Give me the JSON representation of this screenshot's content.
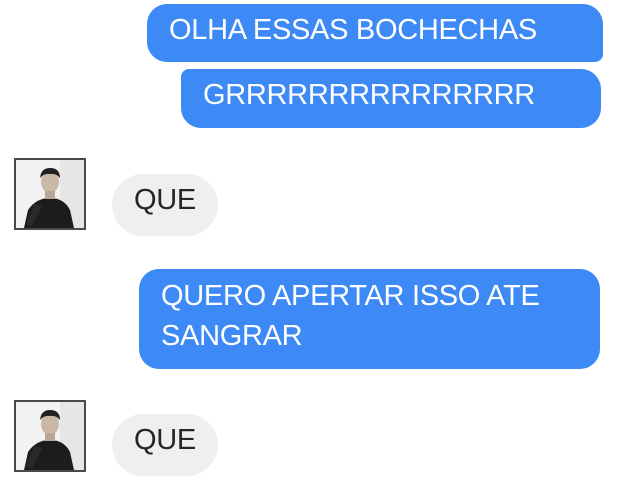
{
  "messages": [
    {
      "direction": "outgoing",
      "text": "OLHA ESSAS BOCHECHAS"
    },
    {
      "direction": "outgoing",
      "text": "GRRRRRRRRRRRRRRR"
    },
    {
      "direction": "incoming",
      "text": "QUE"
    },
    {
      "direction": "outgoing",
      "text": "QUERO APERTAR ISSO ATE SANGRAR"
    },
    {
      "direction": "incoming",
      "text": "QUE"
    }
  ],
  "colors": {
    "outgoing_bubble": "#3d8af7",
    "outgoing_text": "#ffffff",
    "incoming_bubble": "#efeff0",
    "incoming_text": "#262626"
  },
  "icons": {
    "avatar": "contact-avatar-photo"
  }
}
